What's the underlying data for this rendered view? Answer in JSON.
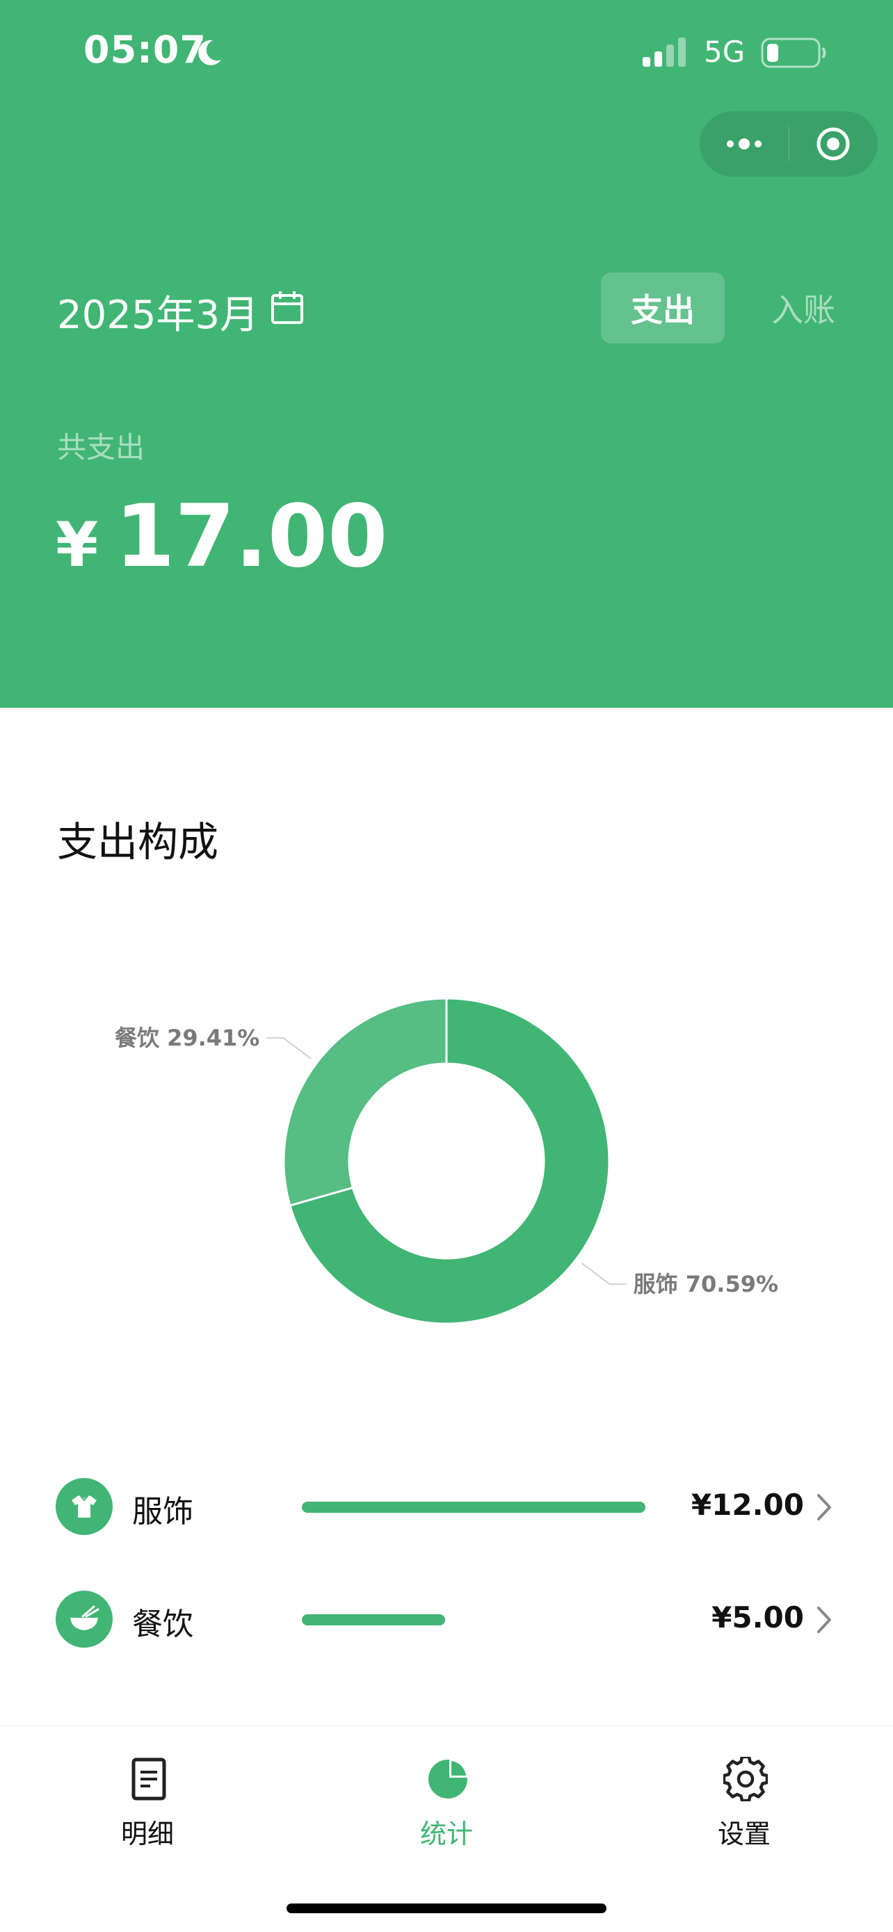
{
  "status_bar": {
    "time": "05:07",
    "network": "5G"
  },
  "header": {
    "date": "2025年3月",
    "tabs": [
      {
        "label": "支出",
        "active": true
      },
      {
        "label": "入账",
        "active": false
      }
    ],
    "total_caption": "共支出",
    "currency_symbol": "¥",
    "total_amount": "17.00"
  },
  "composition": {
    "title": "支出构成"
  },
  "chart_data": {
    "type": "pie",
    "donut": true,
    "slices": [
      {
        "label": "服饰",
        "value": 12.0,
        "percent_label": "70.59%",
        "color": "#41b574"
      },
      {
        "label": "餐饮",
        "value": 5.0,
        "percent_label": "29.41%",
        "color": "#56bd83"
      }
    ]
  },
  "categories": [
    {
      "name": "服饰",
      "amount": "¥12.00",
      "icon": "shirt-icon",
      "fraction": 1.0
    },
    {
      "name": "餐饮",
      "amount": "¥5.00",
      "icon": "bowl-icon",
      "fraction": 0.4167
    }
  ],
  "tabbar": {
    "items": [
      {
        "label": "明细",
        "icon": "document-icon",
        "active": false
      },
      {
        "label": "统计",
        "icon": "pie-chart-icon",
        "active": true
      },
      {
        "label": "设置",
        "icon": "gear-icon",
        "active": false
      }
    ]
  },
  "colors": {
    "primary": "#41b574",
    "secondary_slice": "#56bd83"
  }
}
